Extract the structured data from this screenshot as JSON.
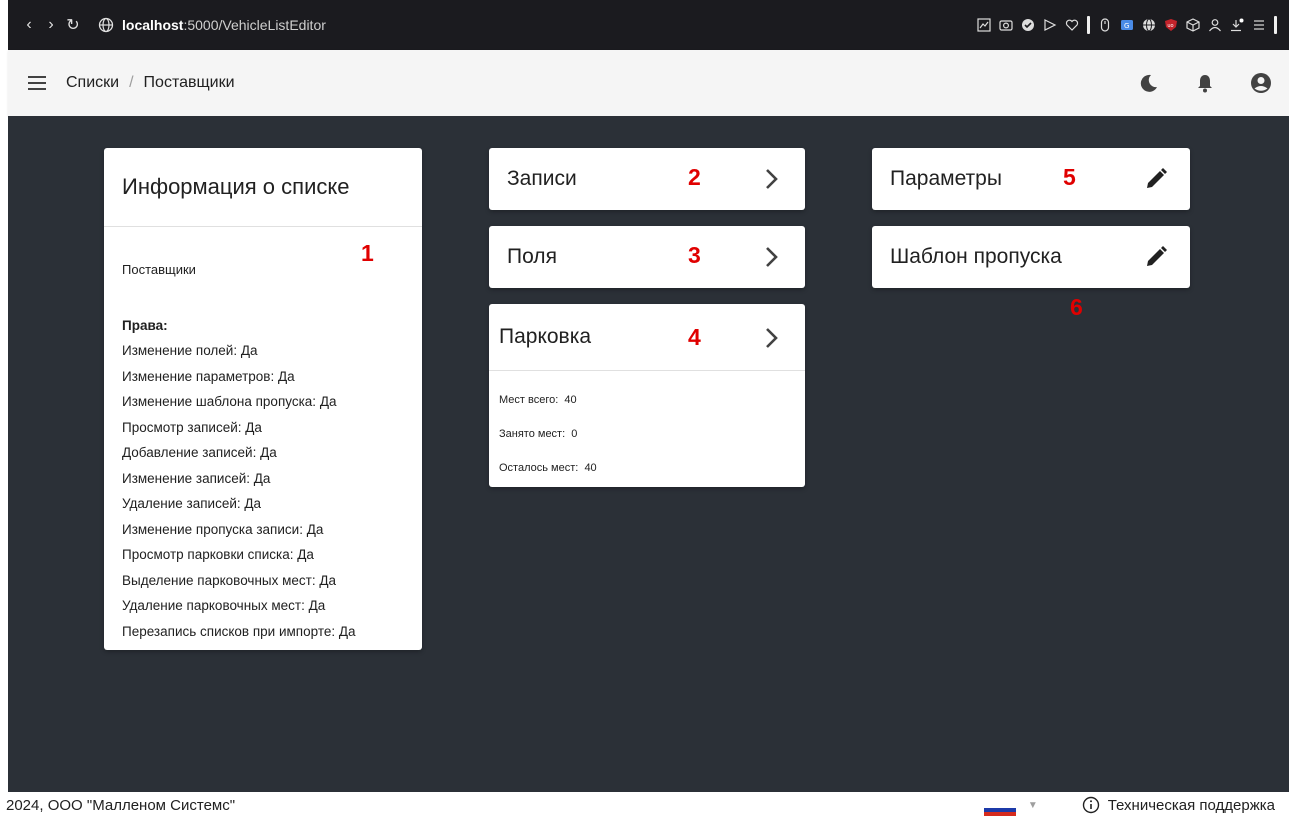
{
  "browser": {
    "url_host": "localhost",
    "url_rest": ":5000/VehicleListEditor"
  },
  "header": {
    "breadcrumb": [
      "Списки",
      "Поставщики"
    ],
    "separator": "/"
  },
  "info_card": {
    "title": "Информация о списке",
    "list_name": "Поставщики",
    "rights_title": "Права:",
    "rights": [
      "Изменение полей: Да",
      "Изменение параметров: Да",
      "Изменение шаблона пропуска: Да",
      "Просмотр записей: Да",
      "Добавление записей: Да",
      "Изменение записей: Да",
      "Удаление записей: Да",
      "Изменение пропуска записи: Да",
      "Просмотр парковки списка: Да",
      "Выделение парковочных мест: Да",
      "Удаление парковочных мест: Да",
      "Перезапись списков при импорте: Да"
    ]
  },
  "cards": {
    "records": "Записи",
    "fields": "Поля",
    "parking": "Парковка",
    "params": "Параметры",
    "template": "Шаблон пропуска"
  },
  "parking": {
    "total_label": "Мест всего:",
    "total": "40",
    "occupied_label": "Занято мест:",
    "occupied": "0",
    "left_label": "Осталось мест:",
    "left": "40"
  },
  "markers": [
    "1",
    "2",
    "3",
    "4",
    "5",
    "6"
  ],
  "footer": {
    "copyright": "2024, ООО \"Малленом Системс\"",
    "support": "Техническая поддержка"
  },
  "colors": {
    "content_bg": "#2b3037",
    "marker": "#e00000",
    "header_bg": "#f5f5f5"
  }
}
